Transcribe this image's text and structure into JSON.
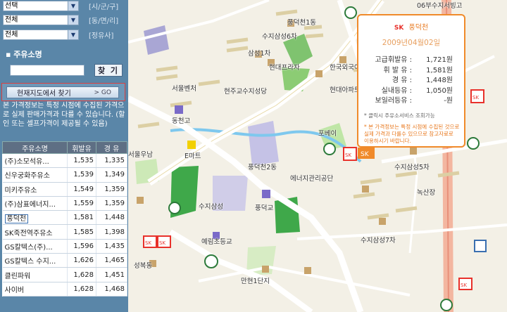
{
  "filters": [
    {
      "value": "선택",
      "tag": "[시/군/구]"
    },
    {
      "value": "전체",
      "tag": "[동/면/리]"
    },
    {
      "value": "전체",
      "tag": "[정유사]"
    }
  ],
  "search": {
    "label": "주유소명",
    "button": "찾 기"
  },
  "find_on_map": {
    "label": "현재지도에서 찾기",
    "go": "> GO"
  },
  "notice": "본 가격정보는 특정 시점에 수집된 가격으로 실제 판매가격과 다를 수 있습니다. (할인 또는 셀프가격이 제공될 수 있음)",
  "table": {
    "headers": [
      "주유소명",
      "휘발유",
      "경 유"
    ],
    "rows": [
      [
        "(주)소모석유...",
        "1,535",
        "1,335"
      ],
      [
        "신우궁화주유소",
        "1,539",
        "1,349"
      ],
      [
        "미키주유소",
        "1,549",
        "1,359"
      ],
      [
        "(주)삼표에너지...",
        "1,559",
        "1,359"
      ],
      [
        "풍덕천",
        "1,581",
        "1,448"
      ],
      [
        "SK죽전역주유소",
        "1,585",
        "1,398"
      ],
      [
        "GS칼텍스(주)...",
        "1,596",
        "1,435"
      ],
      [
        "GS칼텍스 수지...",
        "1,626",
        "1,465"
      ],
      [
        "클린파워",
        "1,628",
        "1,451"
      ],
      [
        "사이버",
        "1,628",
        "1,468"
      ]
    ]
  },
  "popup": {
    "brand": "SK",
    "name": "풍덕천",
    "date": "2009년04월02일",
    "prices": [
      {
        "label": "고급휘발유 :",
        "value": "1,721원"
      },
      {
        "label": "휘 발 유 :",
        "value": "1,581원"
      },
      {
        "label": "경 유 :",
        "value": "1,448원"
      },
      {
        "label": "실내등유 :",
        "value": "1,050원"
      },
      {
        "label": "보일러등유 :",
        "value": "-원"
      }
    ],
    "note1": "* 클릭시 주유소서비스 조회가능",
    "note2": "* 본 가격정보는 특정 시점에 수집된 것으로 실제 가격과 다를수 있으므로 참고자료로 이용하시기 바랍니다."
  },
  "map_labels": [
    "수지삼성6차",
    "풍덕천1동",
    "삼성1차",
    "현대프라자",
    "한국외국어대학교",
    "서울벤처",
    "현주교",
    "수지성당",
    "동천고",
    "현대아파트",
    "서울우남",
    "E마트",
    "포베이",
    "풍덕천2동",
    "에너지관리공단",
    "수지삼성5차",
    "녹산장",
    "수지삼성",
    "풍덕교",
    "예림초등교",
    "수지삼성7차",
    "성복동",
    "만현1단지",
    "SK",
    "06부수지서빙고"
  ],
  "colors": {
    "panel": "#5a86a8",
    "popup_border": "#f08a2a",
    "sk_red": "#e8312b"
  }
}
